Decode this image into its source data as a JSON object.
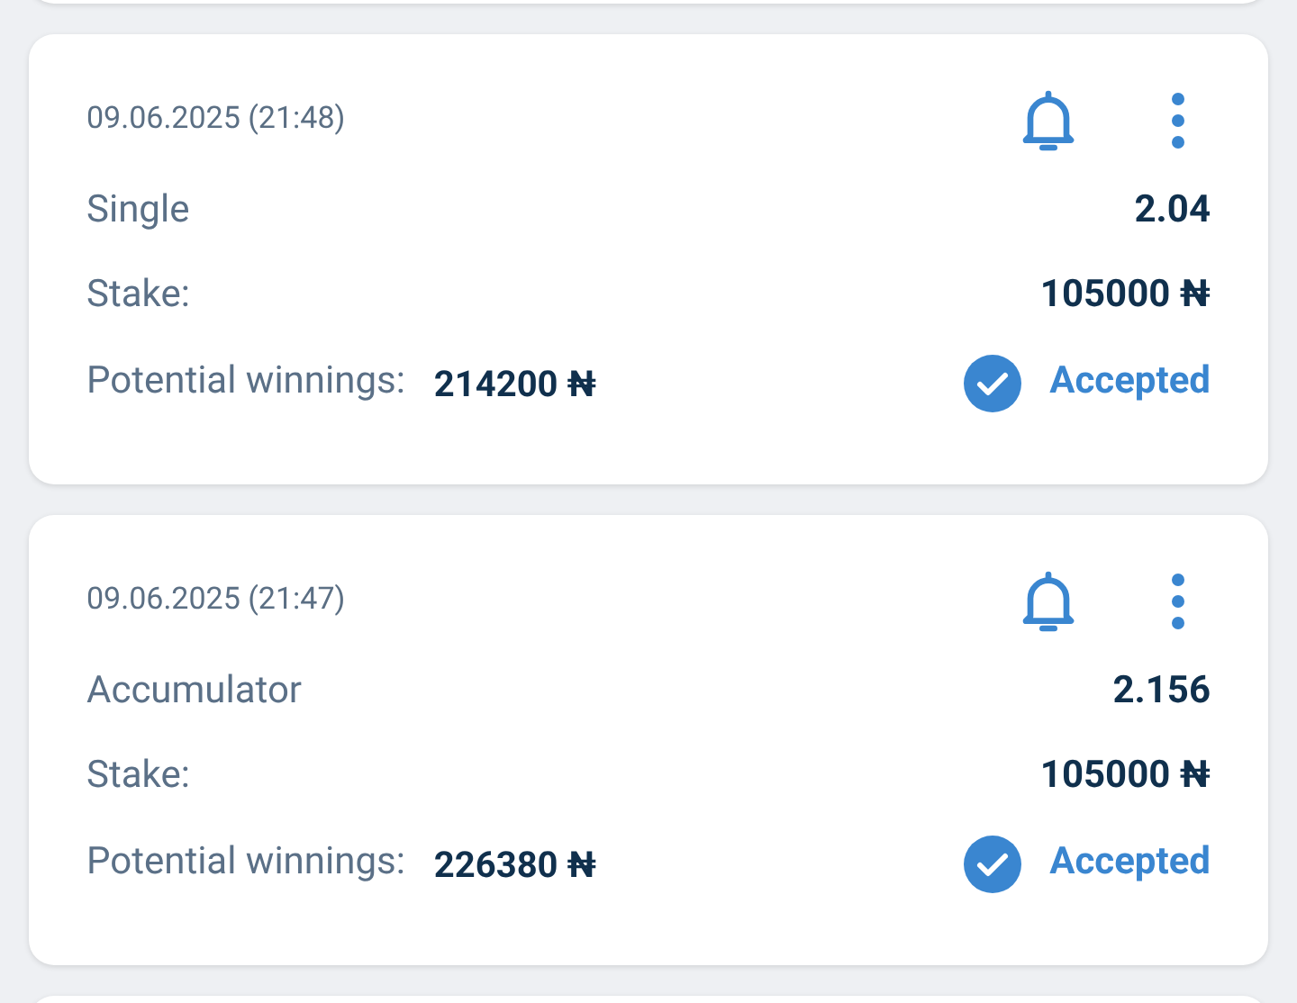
{
  "bets": [
    {
      "date": "09.06.2025 (21:48)",
      "bet_type": "Single",
      "odds": "2.04",
      "stake_label": "Stake:",
      "stake": "105000 ₦",
      "winnings_label": "Potential winnings:",
      "winnings": "214200 ₦",
      "status": "Accepted"
    },
    {
      "date": "09.06.2025 (21:47)",
      "bet_type": "Accumulator",
      "odds": "2.156",
      "stake_label": "Stake:",
      "stake": "105000 ₦",
      "winnings_label": "Potential winnings:",
      "winnings": "226380 ₦",
      "status": "Accepted"
    }
  ]
}
